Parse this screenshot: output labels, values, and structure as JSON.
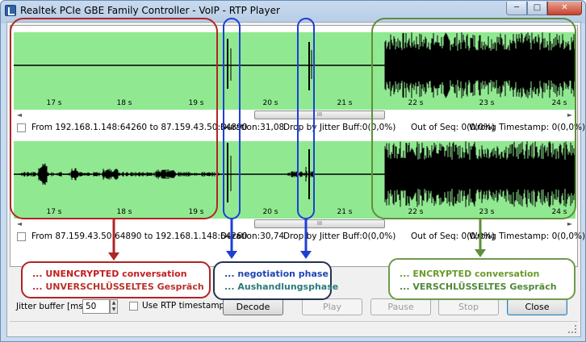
{
  "window": {
    "title": "Realtek PCIe GBE Family Controller - VoIP - RTP Player",
    "minimize_label": "─",
    "maximize_label": "□",
    "close_label": "✕"
  },
  "timeline": {
    "tick_labels": [
      "17 s",
      "18 s",
      "19 s",
      "20 s",
      "21 s",
      "22 s",
      "23 s",
      "24 s"
    ]
  },
  "streams": [
    {
      "info": "From 192.168.1.148:64260 to 87.159.43.50:64890",
      "duration": "Duration:31,08",
      "drop": "Drop by Jitter Buff:0(0,0%)",
      "out_of_seq": "Out of Seq: 0(0,0%)",
      "wrong_ts": "Wrong Timestamp: 0(0,0%)",
      "scroll_thumb": "III"
    },
    {
      "info": "From 87.159.43.50:64890 to 192.168.1.148:64260",
      "duration": "Duration:30,74",
      "drop": "Drop by Jitter Buff:0(0,0%)",
      "out_of_seq": "Out of Seq: 0(0,0%)",
      "wrong_ts": "Wrong Timestamp: 0(0,0%)",
      "scroll_thumb": "III"
    }
  ],
  "controls": {
    "jitter_label": "Jitter buffer [ms]",
    "jitter_value": "50",
    "rtp_timestamp_label": "Use RTP timestamp",
    "decode": "Decode",
    "play": "Play",
    "pause": "Pause",
    "stop": "Stop",
    "close": "Close"
  },
  "annotations": {
    "unencrypted": {
      "line1": "... UNENCRYPTED conversation",
      "line2": "... UNVERSCHLÜSSELTES Gespräch"
    },
    "negotiation": {
      "line1": "... negotiation phase",
      "line2": "... Aushandlungsphase"
    },
    "encrypted": {
      "line1": "... ENCRYPTED conversation",
      "line2": "... VERSCHLÜSSELTES Gespräch"
    },
    "colors": {
      "red": "#b02525",
      "blue": "#1e3fd6",
      "green": "#5e8f3a"
    }
  },
  "colors": {
    "wave_bg": "#90e990",
    "signal": "#000000"
  }
}
